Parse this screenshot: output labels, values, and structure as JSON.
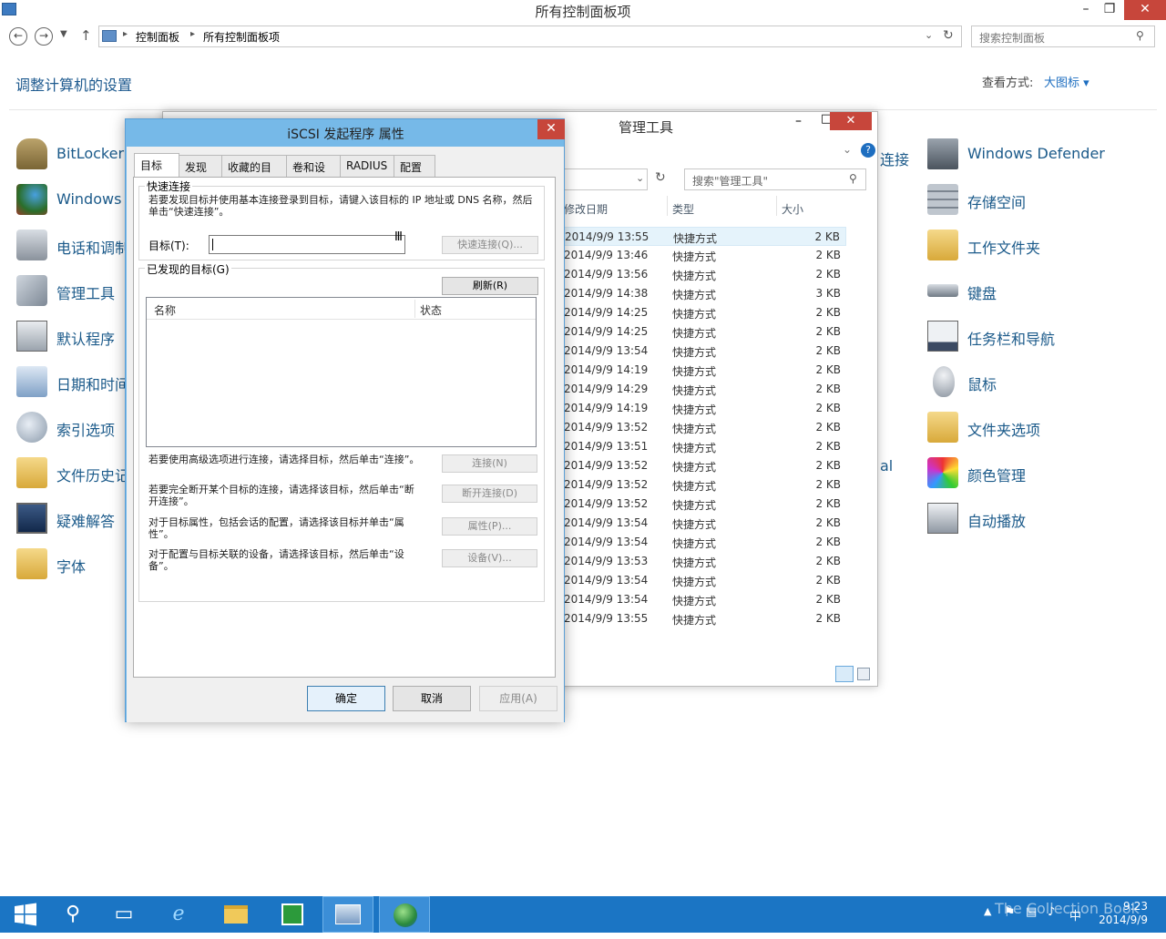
{
  "control_panel": {
    "title": "所有控制面板项",
    "breadcrumb": [
      "控制面板",
      "所有控制面板项"
    ],
    "search_placeholder": "搜索控制面板",
    "heading": "调整计算机的设置",
    "view_by_label": "查看方式:",
    "view_by_value": "大图标 ▾",
    "left_items": [
      "BitLocker",
      "Windows",
      "电话和调制",
      "管理工具",
      "默认程序",
      "日期和时间",
      "索引选项",
      "文件历史记",
      "疑难解答",
      "字体"
    ],
    "right_items": [
      "Windows Defender",
      "存储空间",
      "工作文件夹",
      "键盘",
      "任务栏和导航",
      "鼠标",
      "文件夹选项",
      "颜色管理",
      "自动播放"
    ],
    "partial_text": [
      "连接",
      "al"
    ]
  },
  "admin_tools": {
    "title": "管理工具",
    "search_placeholder": "搜索\"管理工具\"",
    "columns": [
      "修改日期",
      "类型",
      "大小"
    ],
    "rows": [
      {
        "date": "2014/9/9 13:55",
        "type": "快捷方式",
        "size": "2 KB"
      },
      {
        "date": "2014/9/9 13:46",
        "type": "快捷方式",
        "size": "2 KB"
      },
      {
        "date": "2014/9/9 13:56",
        "type": "快捷方式",
        "size": "2 KB"
      },
      {
        "date": "2014/9/9 14:38",
        "type": "快捷方式",
        "size": "3 KB"
      },
      {
        "date": "2014/9/9 14:25",
        "type": "快捷方式",
        "size": "2 KB"
      },
      {
        "date": "2014/9/9 14:25",
        "type": "快捷方式",
        "size": "2 KB"
      },
      {
        "date": "2014/9/9 13:54",
        "type": "快捷方式",
        "size": "2 KB"
      },
      {
        "date": "2014/9/9 14:19",
        "type": "快捷方式",
        "size": "2 KB"
      },
      {
        "date": "2014/9/9 14:29",
        "type": "快捷方式",
        "size": "2 KB"
      },
      {
        "date": "2014/9/9 14:19",
        "type": "快捷方式",
        "size": "2 KB"
      },
      {
        "date": "2014/9/9 13:52",
        "type": "快捷方式",
        "size": "2 KB"
      },
      {
        "date": "2014/9/9 13:51",
        "type": "快捷方式",
        "size": "2 KB"
      },
      {
        "date": "2014/9/9 13:52",
        "type": "快捷方式",
        "size": "2 KB"
      },
      {
        "date": "2014/9/9 13:52",
        "type": "快捷方式",
        "size": "2 KB"
      },
      {
        "date": "2014/9/9 13:52",
        "type": "快捷方式",
        "size": "2 KB"
      },
      {
        "date": "2014/9/9 13:54",
        "type": "快捷方式",
        "size": "2 KB"
      },
      {
        "date": "2014/9/9 13:54",
        "type": "快捷方式",
        "size": "2 KB"
      },
      {
        "date": "2014/9/9 13:53",
        "type": "快捷方式",
        "size": "2 KB"
      },
      {
        "date": "2014/9/9 13:54",
        "type": "快捷方式",
        "size": "2 KB"
      },
      {
        "date": "2014/9/9 13:54",
        "type": "快捷方式",
        "size": "2 KB"
      },
      {
        "date": "2014/9/9 13:55",
        "type": "快捷方式",
        "size": "2 KB"
      }
    ]
  },
  "iscsi": {
    "title": "iSCSI 发起程序 属性",
    "tabs": [
      "目标",
      "发现",
      "收藏的目标",
      "卷和设备",
      "RADIUS",
      "配置"
    ],
    "quick_connect_label": "快速连接",
    "quick_connect_desc": "若要发现目标并使用基本连接登录到目标，请键入该目标的 IP 地址或 DNS 名称，然后单击“快速连接”。",
    "target_label": "目标(T):",
    "target_value": "",
    "quick_connect_btn": "快速连接(Q)...",
    "discovered_label": "已发现的目标(G)",
    "refresh_btn": "刷新(R)",
    "list_columns": [
      "名称",
      "状态"
    ],
    "action_rows": [
      {
        "desc": "若要使用高级选项进行连接，请选择目标，然后单击“连接”。",
        "btn": "连接(N)"
      },
      {
        "desc": "若要完全断开某个目标的连接，请选择该目标，然后单击“断开连接”。",
        "btn": "断开连接(D)"
      },
      {
        "desc": "对于目标属性，包括会话的配置，请选择该目标并单击“属性”。",
        "btn": "属性(P)..."
      },
      {
        "desc": "对于配置与目标关联的设备，请选择该目标，然后单击“设备”。",
        "btn": "设备(V)..."
      }
    ],
    "ok_btn": "确定",
    "cancel_btn": "取消",
    "apply_btn": "应用(A)"
  },
  "taskbar": {
    "time": "9:23",
    "date": "2014/9/9",
    "ime": "中",
    "watermark": "The Collection Book"
  },
  "colors": {
    "accent": "#1b75c4",
    "close_red": "#c7463b",
    "dialog_frame": "#76b9e8",
    "link_blue": "#1b5a8a"
  }
}
